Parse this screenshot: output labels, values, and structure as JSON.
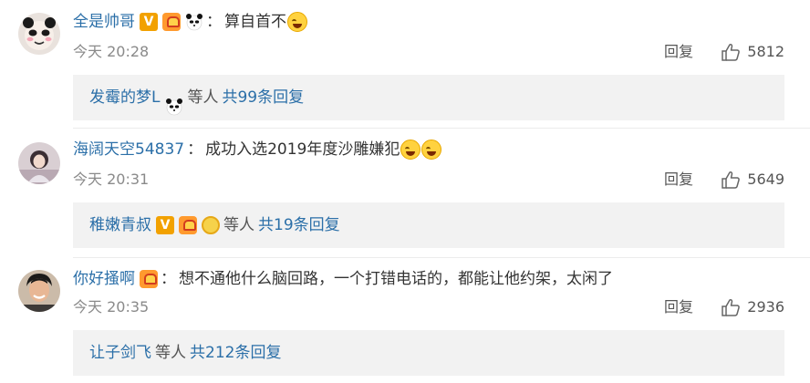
{
  "comments": [
    {
      "username": "全是帅哥",
      "text": "算自首不",
      "time": "今天 20:28",
      "reply_label": "回复",
      "likes": "5812",
      "replies": {
        "user": "发霉的梦L",
        "mid": "等人",
        "link": "共99条回复"
      }
    },
    {
      "username": "海阔天空54837",
      "text": "成功入选2019年度沙雕嫌犯",
      "time": "今天 20:31",
      "reply_label": "回复",
      "likes": "5649",
      "replies": {
        "user": "稚嫩青叔",
        "mid": "等人",
        "link": "共19条回复"
      }
    },
    {
      "username": "你好搔啊",
      "text": "想不通他什么脑回路，一个打错电话的，都能让他约架，太闲了",
      "time": "今天 20:35",
      "reply_label": "回复",
      "likes": "2936",
      "replies": {
        "user": "让子剑飞",
        "mid": "等人",
        "link": "共212条回复"
      }
    }
  ],
  "separator": "：",
  "icons": {
    "verified": "V",
    "fan_badge": "fan-badge-icon",
    "panda": "panda-icon",
    "emoji": "laugh-cry-emoji",
    "like": "thumbs-up-icon",
    "medal": "medal-icon"
  },
  "colors": {
    "link_blue": "#2b6fa8",
    "meta_gray": "#8a8a8a",
    "reply_bg": "#f2f2f2"
  }
}
